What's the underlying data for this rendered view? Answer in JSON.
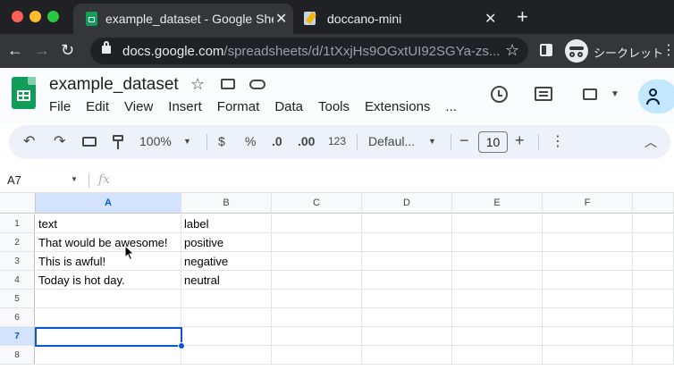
{
  "browser": {
    "tabs": [
      {
        "title": "example_dataset - Google Sheets",
        "icon": "sheets-icon",
        "active": true
      },
      {
        "title": "doccano-mini",
        "icon": "notepad-icon",
        "active": false
      }
    ],
    "url_host": "docs.google.com",
    "url_path": "/spreadsheets/d/1tXxjHs9OGxtUI92SGYa-zs...",
    "profile_label": "シークレット"
  },
  "sheets": {
    "doc_title": "example_dataset",
    "menu": [
      "File",
      "Edit",
      "View",
      "Insert",
      "Format",
      "Data",
      "Tools",
      "Extensions",
      "..."
    ],
    "toolbar": {
      "zoom": "100%",
      "currency": "$",
      "percent": "%",
      "decrease_decimal": ".0",
      "increase_decimal": ".00",
      "number_format": "123",
      "font": "Defaul...",
      "font_size": "10"
    },
    "name_box": "A7",
    "fx": "fx",
    "columns": [
      "A",
      "B",
      "C",
      "D",
      "E",
      "F"
    ],
    "rows": [
      {
        "num": "1",
        "a": "text",
        "b": "label"
      },
      {
        "num": "2",
        "a": "That would be awesome!",
        "b": "positive"
      },
      {
        "num": "3",
        "a": "This is awful!",
        "b": "negative"
      },
      {
        "num": "4",
        "a": "Today is hot day.",
        "b": "neutral"
      },
      {
        "num": "5",
        "a": "",
        "b": ""
      },
      {
        "num": "6",
        "a": "",
        "b": ""
      },
      {
        "num": "7",
        "a": "",
        "b": ""
      },
      {
        "num": "8",
        "a": "",
        "b": ""
      }
    ],
    "selected_cell": "A7",
    "accent_color": "#0b57d0",
    "sheets_green": "#0f9d58"
  }
}
